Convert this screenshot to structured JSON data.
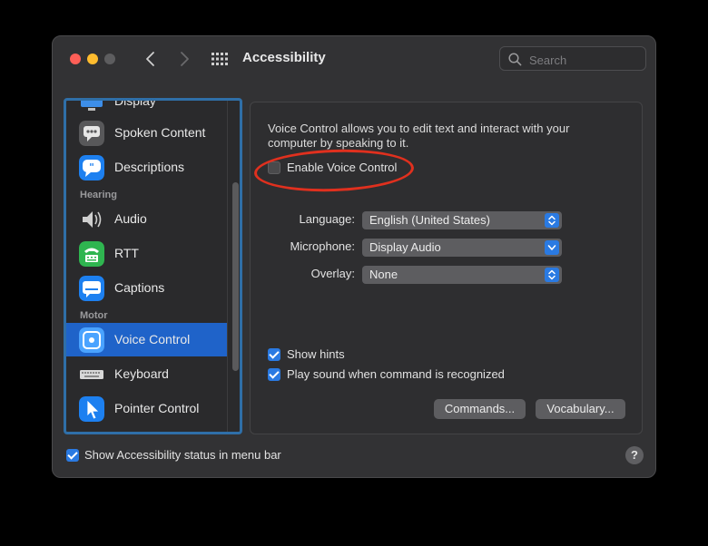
{
  "window": {
    "title": "Accessibility"
  },
  "search": {
    "placeholder": "Search"
  },
  "sidebar": {
    "items": [
      {
        "label": "Display"
      },
      {
        "label": "Spoken Content"
      },
      {
        "label": "Descriptions"
      },
      {
        "label": "Audio"
      },
      {
        "label": "RTT"
      },
      {
        "label": "Captions"
      },
      {
        "label": "Voice Control",
        "selected": true
      },
      {
        "label": "Keyboard"
      },
      {
        "label": "Pointer Control"
      }
    ],
    "sections": {
      "hearing": "Hearing",
      "motor": "Motor"
    }
  },
  "voice_control": {
    "description": "Voice Control allows you to edit text and interact with your computer by speaking to it.",
    "enable_label": "Enable Voice Control",
    "enable_checked": false,
    "language_label": "Language:",
    "language_value": "English (United States)",
    "microphone_label": "Microphone:",
    "microphone_value": "Display Audio",
    "overlay_label": "Overlay:",
    "overlay_value": "None",
    "show_hints_label": "Show hints",
    "show_hints_checked": true,
    "play_sound_label": "Play sound when command is recognized",
    "play_sound_checked": true,
    "commands_button": "Commands...",
    "vocabulary_button": "Vocabulary..."
  },
  "footer": {
    "status_label": "Show Accessibility status in menu bar",
    "status_checked": true,
    "help_label": "?"
  },
  "colors": {
    "accent": "#2a7ae2",
    "selection": "#1f63c9",
    "annotation_ring": "#e0301e",
    "sidebar_focus": "#2f6fa8"
  }
}
